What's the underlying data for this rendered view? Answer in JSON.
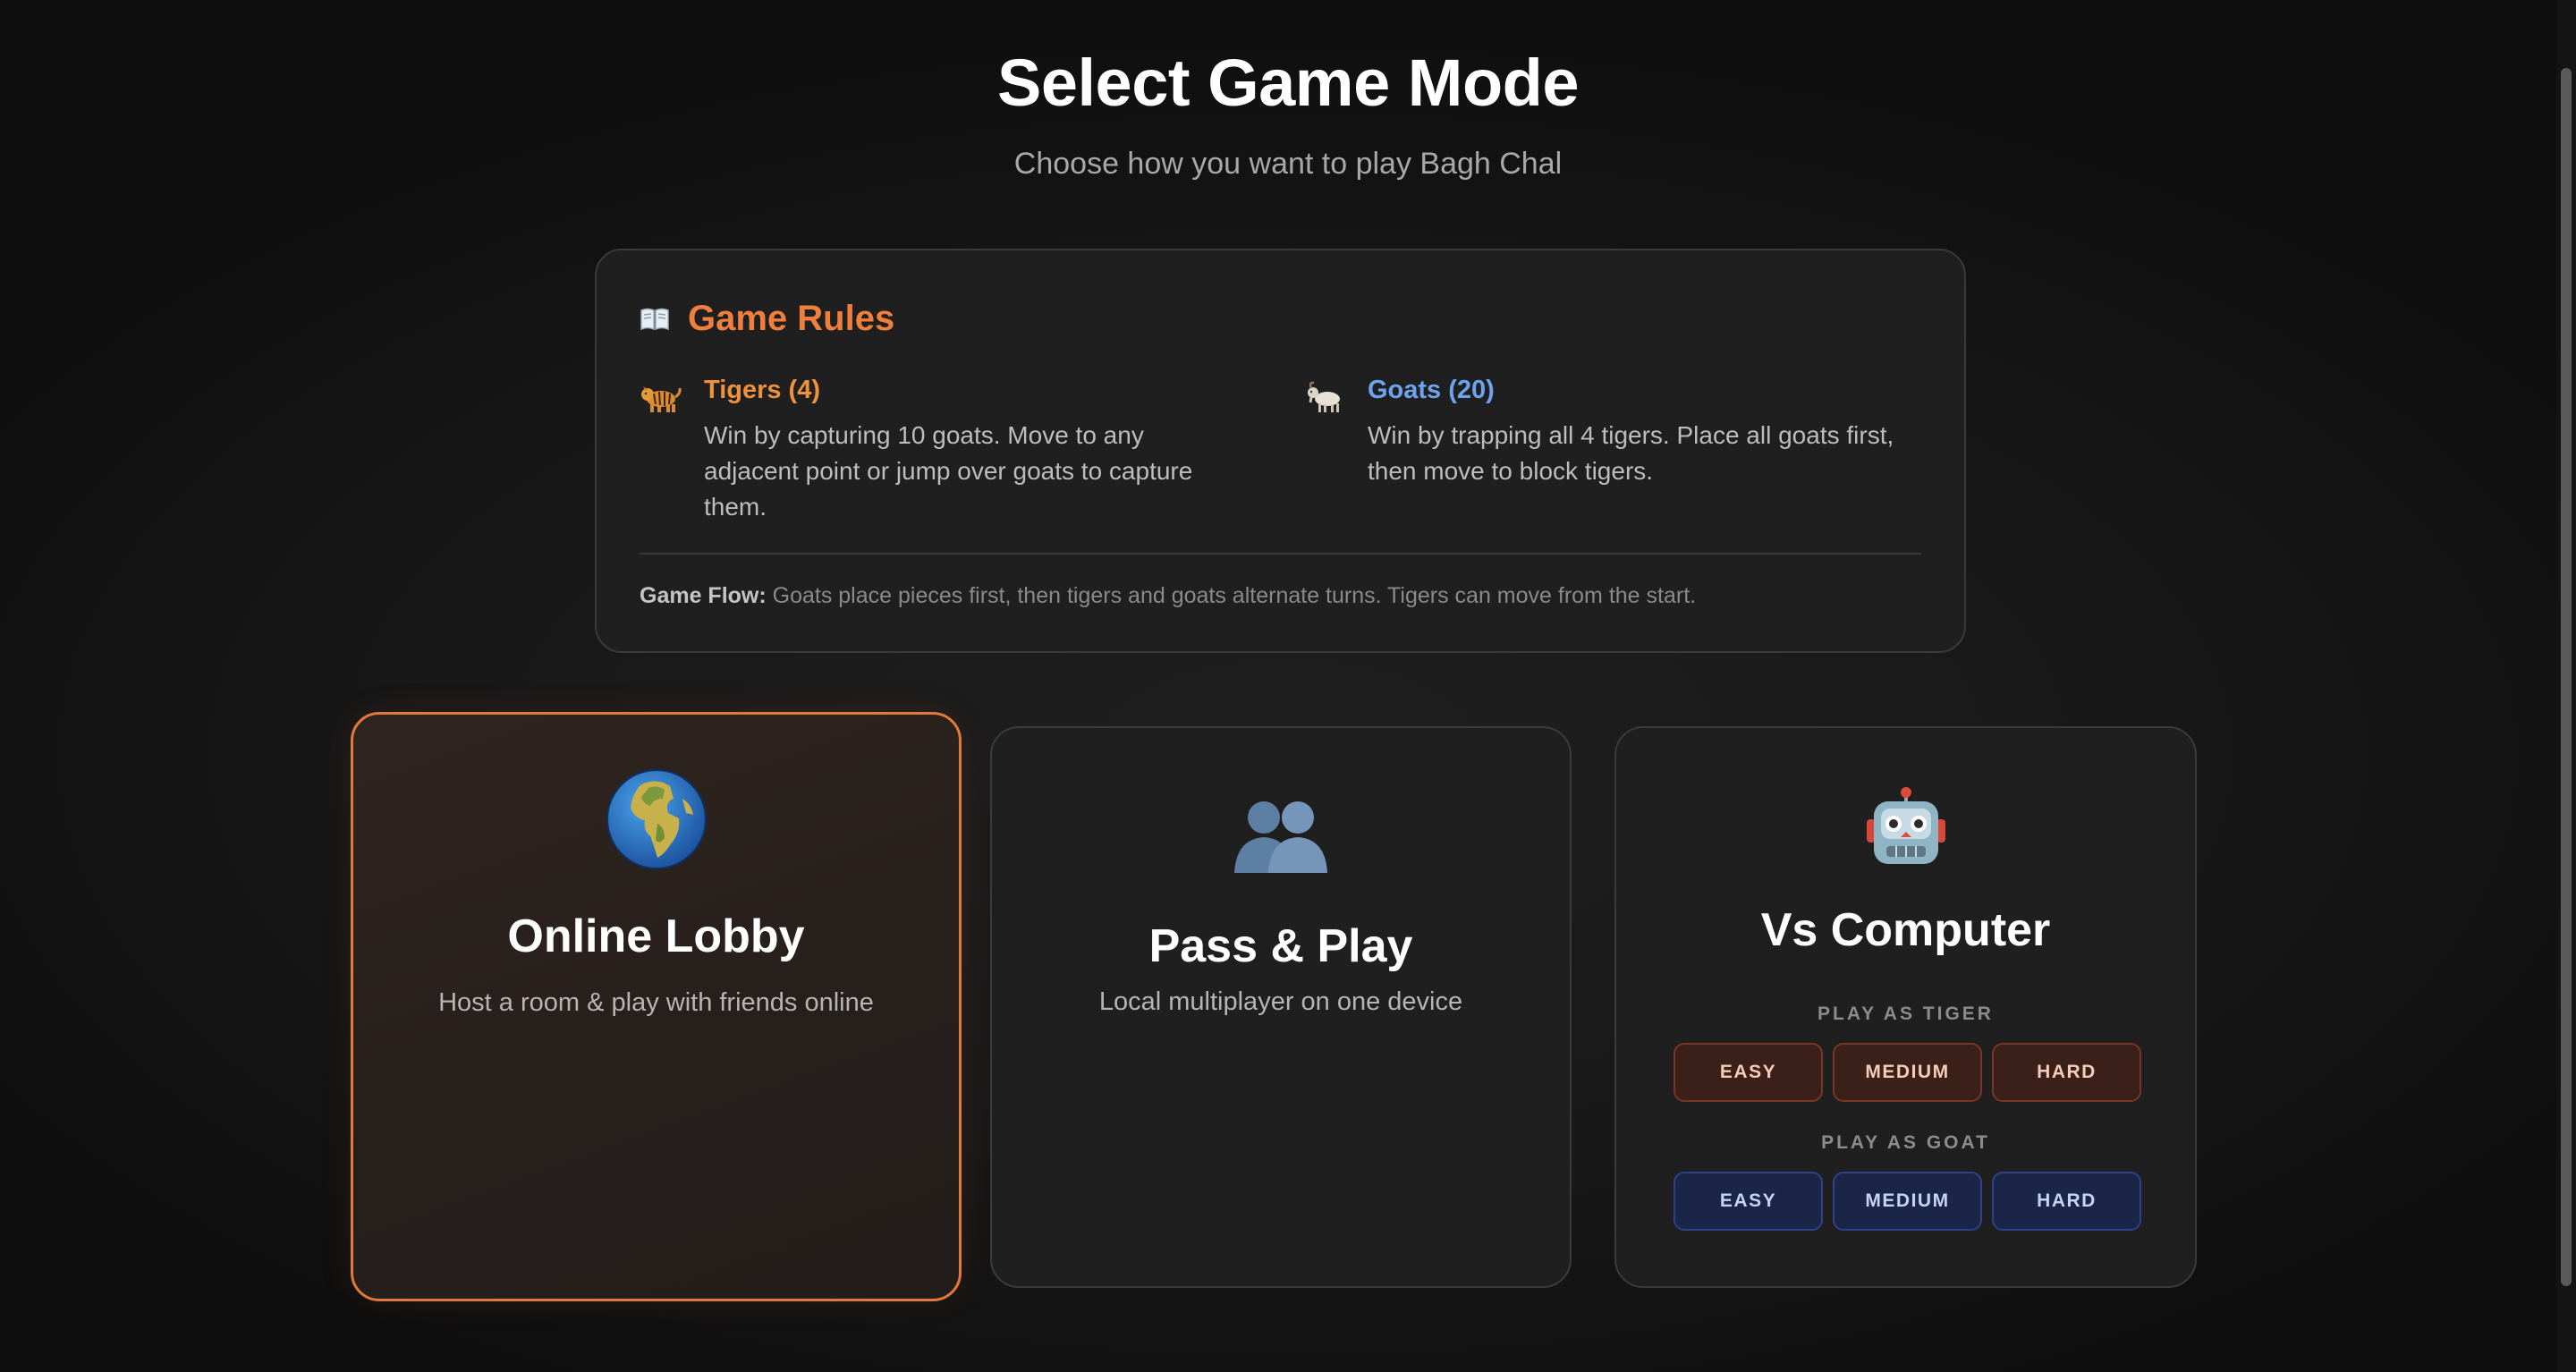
{
  "header": {
    "title": "Select Game Mode",
    "subtitle": "Choose how you want to play Bagh Chal"
  },
  "rules": {
    "title": "Game Rules",
    "icon": "book-icon",
    "tiger": {
      "icon": "tiger-icon",
      "name": "Tigers (4)",
      "description": "Win by capturing 10 goats. Move to any adjacent point or jump over goats to capture them."
    },
    "goat": {
      "icon": "goat-icon",
      "name": "Goats (20)",
      "description": "Win by trapping all 4 tigers. Place all goats first, then move to block tigers."
    },
    "flow_label": "Game Flow:",
    "flow_text": " Goats place pieces first, then tigers and goats alternate turns. Tigers can move from the start."
  },
  "modes": {
    "online": {
      "icon": "globe-icon",
      "title": "Online Lobby",
      "description": "Host a room & play with friends online"
    },
    "pass": {
      "icon": "two-people-icon",
      "title": "Pass & Play",
      "description": "Local multiplayer on one device"
    },
    "cpu": {
      "icon": "robot-icon",
      "title": "Vs Computer",
      "tiger_label": "PLAY AS TIGER",
      "goat_label": "PLAY AS GOAT",
      "tiger_buttons": [
        "EASY",
        "MEDIUM",
        "HARD"
      ],
      "goat_buttons": [
        "EASY",
        "MEDIUM",
        "HARD"
      ]
    }
  },
  "colors": {
    "accent_orange": "#ef7f3d",
    "goat_blue": "#6ea3ee",
    "background": "#151515"
  }
}
